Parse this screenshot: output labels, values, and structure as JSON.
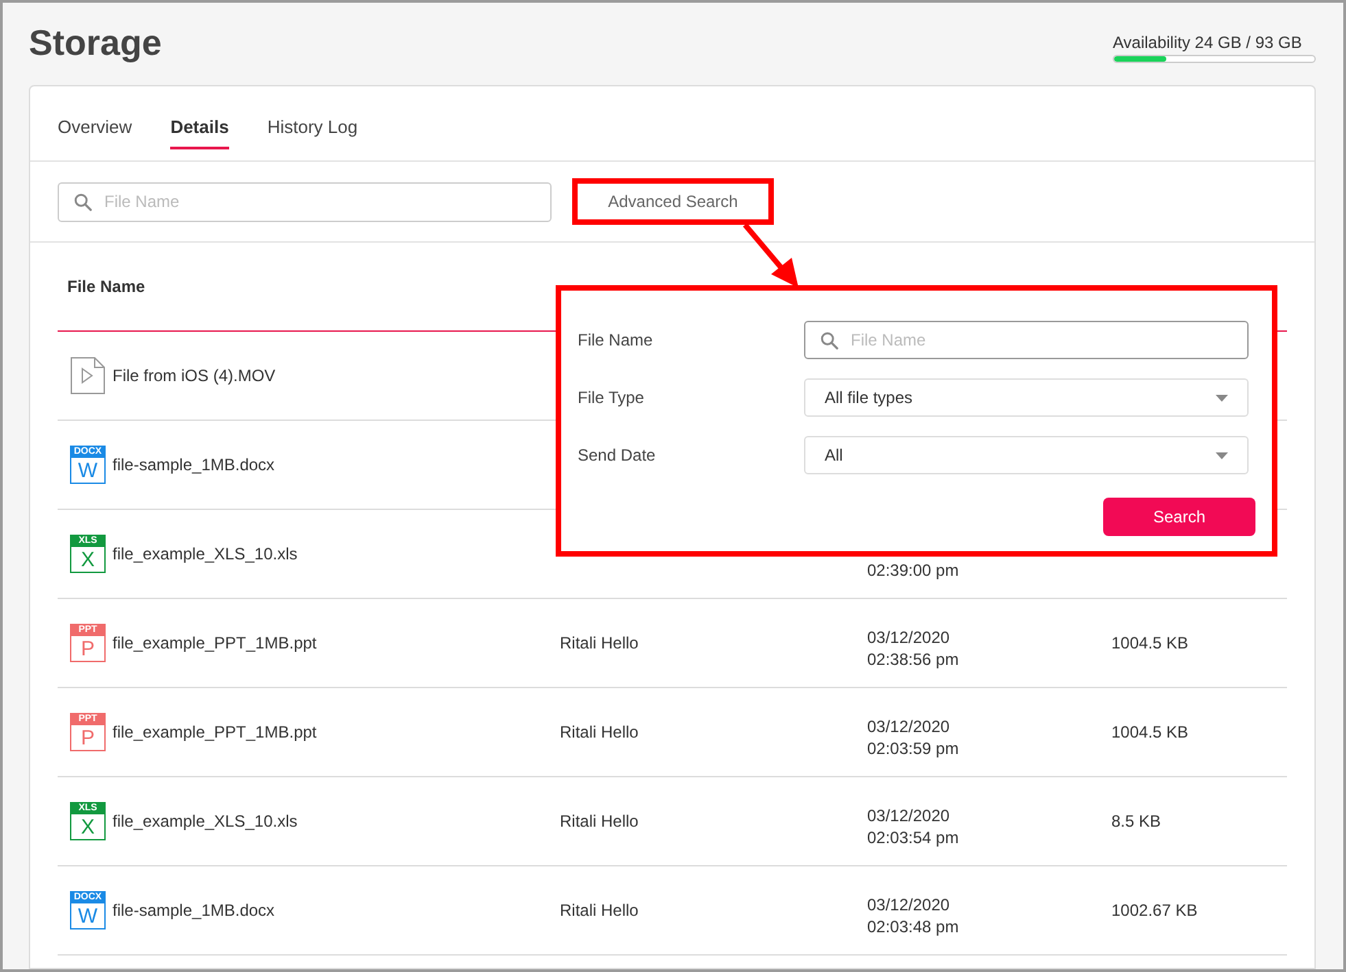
{
  "page": {
    "title": "Storage"
  },
  "availability": {
    "label": "Availability 24 GB / 93 GB",
    "level": 0.26
  },
  "tabs": [
    {
      "label": "Overview",
      "selected": false
    },
    {
      "label": "Details",
      "selected": true
    },
    {
      "label": "History Log",
      "selected": false
    }
  ],
  "search": {
    "placeholder": "File Name"
  },
  "advanced_search_button": "Advanced Search",
  "table": {
    "columns": [
      "File Name"
    ],
    "rows": [
      {
        "kind": "video",
        "name": "File from iOS (4).MOV"
      },
      {
        "kind": "docx",
        "badge": "DOCX",
        "letter": "W",
        "name": "file-sample_1MB.docx"
      },
      {
        "kind": "xls",
        "badge": "XLS",
        "letter": "X",
        "name": "file_example_XLS_10.xls",
        "time": "02:39:00 pm"
      },
      {
        "kind": "ppt",
        "badge": "PPT",
        "letter": "P",
        "name": "file_example_PPT_1MB.ppt",
        "author": "Ritali Hello",
        "date": "03/12/2020",
        "time": "02:38:56 pm",
        "size": "1004.5 KB"
      },
      {
        "kind": "ppt",
        "badge": "PPT",
        "letter": "P",
        "name": "file_example_PPT_1MB.ppt",
        "author": "Ritali Hello",
        "date": "03/12/2020",
        "time": "02:03:59 pm",
        "size": "1004.5 KB"
      },
      {
        "kind": "xls",
        "badge": "XLS",
        "letter": "X",
        "name": "file_example_XLS_10.xls",
        "author": "Ritali Hello",
        "date": "03/12/2020",
        "time": "02:03:54 pm",
        "size": "8.5 KB"
      },
      {
        "kind": "docx",
        "badge": "DOCX",
        "letter": "W",
        "name": "file-sample_1MB.docx",
        "author": "Ritali Hello",
        "date": "03/12/2020",
        "time": "02:03:48 pm",
        "size": "1002.67 KB"
      }
    ]
  },
  "advanced_search_panel": {
    "fields": [
      {
        "kind": "search",
        "label": "File Name",
        "placeholder": "File Name"
      },
      {
        "kind": "select",
        "label": "File Type",
        "value": "All file types"
      },
      {
        "kind": "select",
        "label": "Send Date",
        "value": "All"
      }
    ],
    "button": "Search"
  }
}
